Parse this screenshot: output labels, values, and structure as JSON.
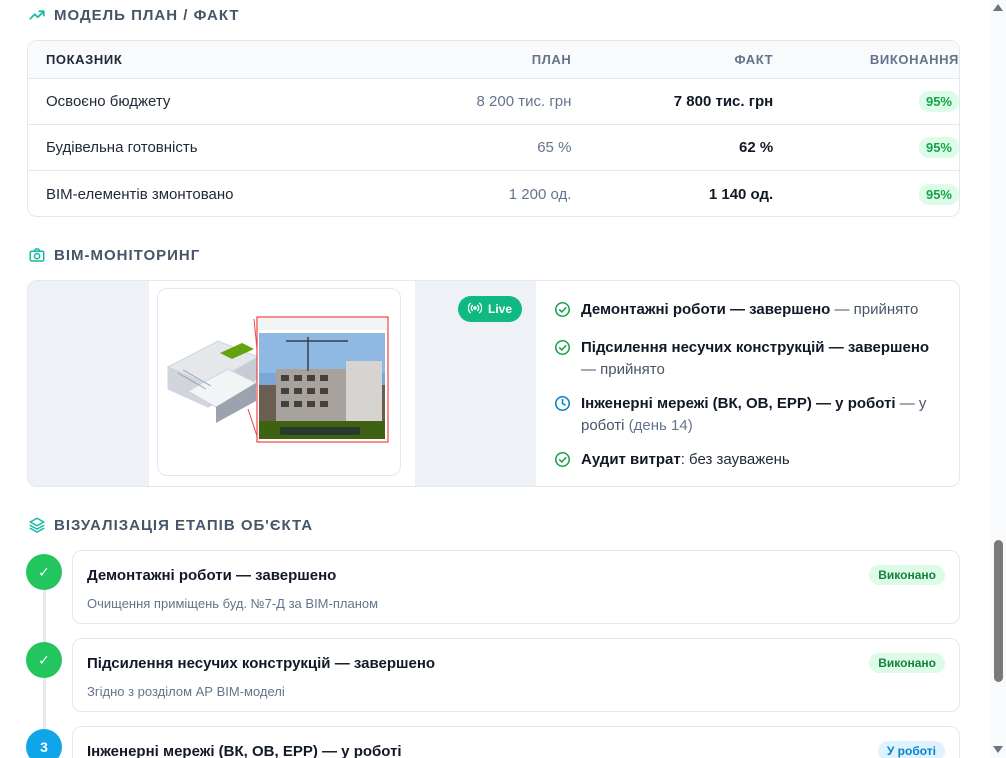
{
  "plan_fact": {
    "title": "МОДЕЛЬ ПЛАН / ФАКТ",
    "icon": "trending-up-icon",
    "columns": [
      "ПОКАЗНИК",
      "ПЛАН",
      "ФАКТ",
      "ВИКОНАННЯ"
    ],
    "rows": [
      {
        "name": "Освоєно бюджету",
        "plan": "8 200 тис. грн",
        "fact": "7 800 тис. грн",
        "exec": "95%"
      },
      {
        "name": "Будівельна готовність",
        "plan": "65 %",
        "fact": "62 %",
        "exec": "95%"
      },
      {
        "name": "BIM-елементів змонтовано",
        "plan": "1 200 од.",
        "fact": "1 140 од.",
        "exec": "95%"
      }
    ]
  },
  "bim": {
    "title": "BIM-МОНІТОРИНГ",
    "icon": "camera-icon",
    "live_label": "Live",
    "items": [
      {
        "icon": "check-circle-icon",
        "bold": "Демонтажні роботи — завершено",
        "rest": " — прийнято",
        "extra": ""
      },
      {
        "icon": "check-circle-icon",
        "bold": "Підсилення несучих конструкцій — завершено",
        "rest": " — прийнято",
        "extra": ""
      },
      {
        "icon": "clock-icon",
        "bold": "Інженерні мережі (ВК, ОВ, ЕРР) — у роботі",
        "rest": " — у роботі",
        "extra": " (день 14)"
      },
      {
        "icon": "check-circle-icon",
        "bold": "Аудит витрат",
        "rest": ": без зауважень",
        "extra": ""
      }
    ]
  },
  "stages": {
    "title": "ВІЗУАЛІЗАЦІЯ ЕТАПІВ ОБ'ЄКТА",
    "icon": "layers-icon",
    "items": [
      {
        "marker": "✓",
        "title": "Демонтажні роботи — завершено",
        "subtitle": "Очищення приміщень буд. №7-Д за BIM-планом",
        "status": "Виконано"
      },
      {
        "marker": "✓",
        "title": "Підсилення несучих конструкцій — завершено",
        "subtitle": "Згідно з розділом АР BIM-моделі",
        "status": "Виконано"
      },
      {
        "marker": "3",
        "title": "Інженерні мережі (ВК, ОВ, ЕРР) — у роботі",
        "subtitle": "",
        "status": "У роботі"
      }
    ]
  },
  "colors": {
    "accent": "#10b981",
    "done": "#22c55e",
    "active": "#0ea5e9",
    "heading": "#475569"
  }
}
